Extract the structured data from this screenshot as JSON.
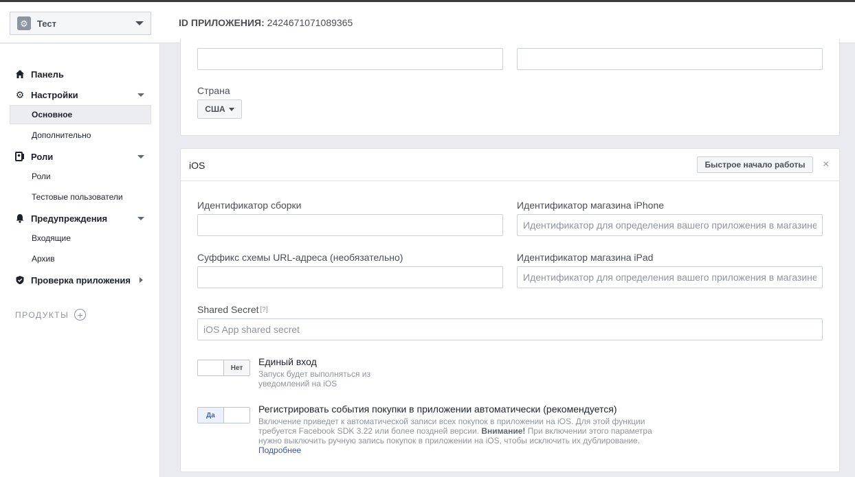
{
  "header": {
    "app_name": "Тест",
    "app_id_label": "ID ПРИЛОЖЕНИЯ:",
    "app_id_value": "2424671071089365"
  },
  "sidebar": {
    "dashboard": "Панель",
    "settings": "Настройки",
    "settings_basic": "Основное",
    "settings_advanced": "Дополнительно",
    "roles": "Роли",
    "roles_roles": "Роли",
    "roles_test_users": "Тестовые пользователи",
    "alerts": "Предупреждения",
    "alerts_inbox": "Входящие",
    "alerts_archive": "Архив",
    "app_review": "Проверка приложения",
    "products": "ПРОДУКТЫ"
  },
  "top_card": {
    "country_label": "Страна",
    "country_value": "США"
  },
  "ios": {
    "title": "iOS",
    "quick_start": "Быстрое начало работы",
    "close": "×",
    "bundle_id_label": "Идентификатор сборки",
    "iphone_store_label": "Идентификатор магазина iPhone",
    "iphone_store_placeholder": "Идентификатор для определения вашего приложения в магазине",
    "url_suffix_label": "Суффикс схемы URL-адреса (необязательно)",
    "ipad_store_label": "Идентификатор магазина iPad",
    "ipad_store_placeholder": "Идентификатор для определения вашего приложения в магазине",
    "shared_secret_label": "Shared Secret",
    "shared_secret_help": "[?]",
    "shared_secret_placeholder": "iOS App shared secret",
    "sso": {
      "toggle_label": "Нет",
      "title": "Единый вход",
      "desc": "Запуск будет выполняться из уведомлений на iOS"
    },
    "iap": {
      "toggle_label": "Да",
      "title": "Регистрировать события покупки в приложении автоматически (рекомендуется)",
      "desc_part1": "Включение приведет к автоматической записи всех покупок в приложении на iOS. Для этой функции требуется Facebook SDK 3.22 или более поздней версии.",
      "desc_warning": "Внимание!",
      "desc_part2": "При включении этого параметра нужно выключить ручную запись покупок в приложении на iOS, чтобы исключить их дублирование.",
      "learn_more": "Подробнее"
    }
  }
}
